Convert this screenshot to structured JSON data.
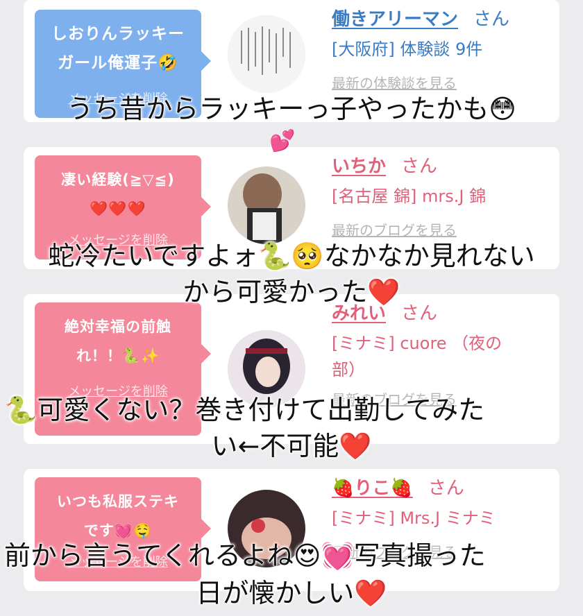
{
  "entries": [
    {
      "bubble_lines": [
        "しおりんラッキー",
        "ガール俺運子🤣"
      ],
      "delete_label": "メッセージを削除",
      "name": "働きアリーマン",
      "honorific": "さん",
      "meta": "[大阪府] 体験談 9件",
      "latest_link": "最新の体験談を見る",
      "theme": "blue"
    },
    {
      "bubble_lines": [
        "凄い経験(≧▽≦)",
        "❤️❤️❤️"
      ],
      "delete_label": "メッセージを削除",
      "name": "いちか",
      "honorific": "さん",
      "meta": "[名古屋 錦] mrs.J 錦",
      "latest_link": "最新のブログを見る",
      "theme": "pink"
    },
    {
      "bubble_lines": [
        "絶対幸福の前触",
        "れ！！🐍✨"
      ],
      "delete_label": "メッセージを削除",
      "name": "みれい",
      "honorific": "さん",
      "meta_lines": [
        "[ミナミ] cuore （夜の",
        "部）"
      ],
      "latest_link": "最新のブログを見る",
      "theme": "pink"
    },
    {
      "bubble_lines": [
        "いつも私服ステキ",
        "です💓🤤"
      ],
      "delete_label": "メッセージを削除",
      "name": "🍓りこ🍓",
      "honorific": "さん",
      "meta": "[ミナミ] Mrs.J ミナミ",
      "latest_link": "最新のブログを見る",
      "theme": "pink"
    }
  ],
  "captions": {
    "c1": "うち昔からラッキーっ子やったかも😳",
    "heart": "💕",
    "c2a": "蛇冷たいですよォ🐍🥺なかなか見れない",
    "c2b": "から可愛かった❤️",
    "c3a": "🐍可愛くない？巻き付けて出勤してみた",
    "c3b": "い←不可能❤️",
    "c4a": "前から言うてくれるよね😍💓写真撮った",
    "c4b": "日が懐かしい❤️"
  },
  "colors": {
    "background": "#ececef",
    "blue_bubble": "#7fb0ee",
    "pink_bubble": "#f5879b",
    "blue_text": "#3a7cc4",
    "pink_text": "#e0607a"
  }
}
